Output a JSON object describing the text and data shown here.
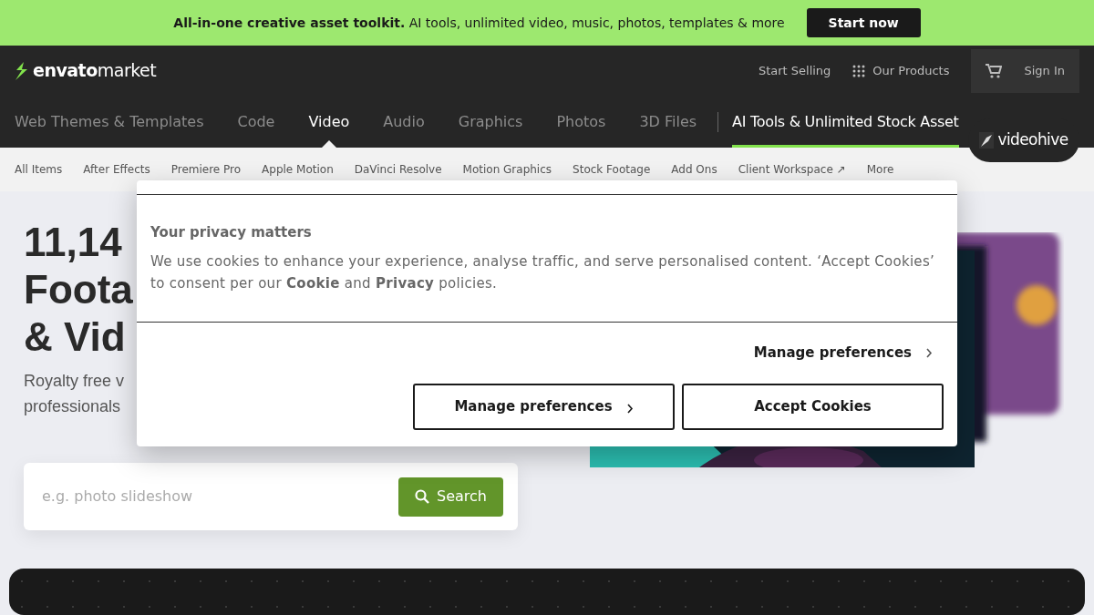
{
  "banner": {
    "text": "**All-in-one creative asset toolkit.** AI tools, unlimited video, music, photos, templates & more",
    "button": "Start now"
  },
  "logo": {
    "brand": "envato",
    "product": "market"
  },
  "header_links": [
    {
      "label": "Start Selling",
      "kind": "plain"
    },
    {
      "label": "Our Products",
      "kind": "grid"
    },
    {
      "label": "Sign In",
      "kind": "cart"
    }
  ],
  "categories": [
    {
      "label": "Web Themes & Templates",
      "selected": false
    },
    {
      "label": "Code",
      "selected": false
    },
    {
      "label": "Video",
      "selected": true
    },
    {
      "label": "Audio",
      "selected": false
    },
    {
      "label": "Graphics",
      "selected": false
    },
    {
      "label": "Photos",
      "selected": false
    },
    {
      "label": "3D Files",
      "selected": false
    }
  ],
  "promo_tab": "AI Tools & Unlimited Stock Asset",
  "site_badge": "videohive",
  "subnav": [
    "All Items",
    "After Effects",
    "Premiere Pro",
    "Apple Motion",
    "DaVinci Resolve",
    "Motion Graphics",
    "Stock Footage",
    "Add Ons",
    "Client Workspace ↗",
    "More"
  ],
  "hero": {
    "heading_lines": [
      "11,14",
      "Foota",
      "& Vid"
    ],
    "subtitle_lines": [
      "Royalty free v",
      "professionals"
    ],
    "search": {
      "placeholder": "e.g. photo slideshow",
      "button": "Search"
    }
  },
  "cookie_dialog": {
    "title": "Your privacy matters",
    "text": "We use cookies to enhance your experience, analyse traffic, and serve personalised content. ‘Accept Cookies’ to consent per our **Cookie** and **Privacy** policies.",
    "link": "Manage preferences",
    "buttons": [
      {
        "label": "Manage preferences",
        "kind": "chevron"
      },
      {
        "label": "Accept Cookies",
        "kind": "plain"
      }
    ]
  }
}
